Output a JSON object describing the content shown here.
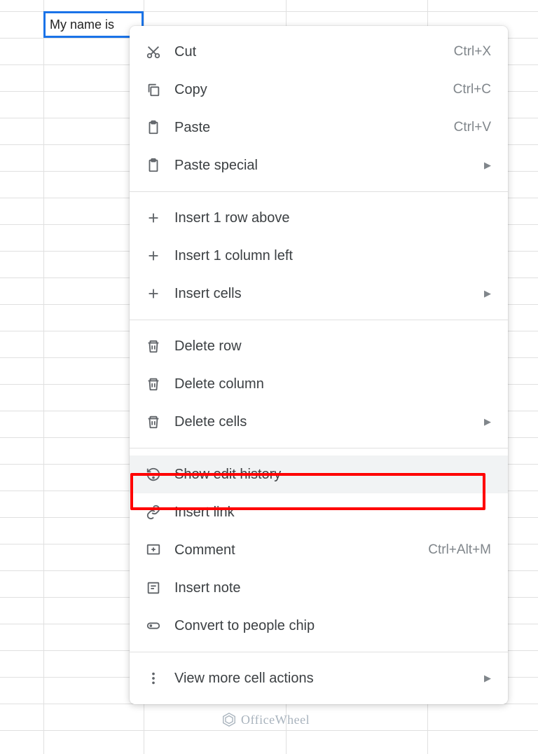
{
  "cell": {
    "value": "My name is"
  },
  "menu": {
    "cut": {
      "label": "Cut",
      "shortcut": "Ctrl+X"
    },
    "copy": {
      "label": "Copy",
      "shortcut": "Ctrl+C"
    },
    "paste": {
      "label": "Paste",
      "shortcut": "Ctrl+V"
    },
    "paste_special": {
      "label": "Paste special"
    },
    "insert_row_above": {
      "label": "Insert 1 row above"
    },
    "insert_column_left": {
      "label": "Insert 1 column left"
    },
    "insert_cells": {
      "label": "Insert cells"
    },
    "delete_row": {
      "label": "Delete row"
    },
    "delete_column": {
      "label": "Delete column"
    },
    "delete_cells": {
      "label": "Delete cells"
    },
    "show_edit_history": {
      "label": "Show edit history"
    },
    "insert_link": {
      "label": "Insert link"
    },
    "comment": {
      "label": "Comment",
      "shortcut": "Ctrl+Alt+M"
    },
    "insert_note": {
      "label": "Insert note"
    },
    "convert_people_chip": {
      "label": "Convert to people chip"
    },
    "view_more": {
      "label": "View more cell actions"
    }
  },
  "watermark": {
    "text": "OfficeWheel"
  }
}
